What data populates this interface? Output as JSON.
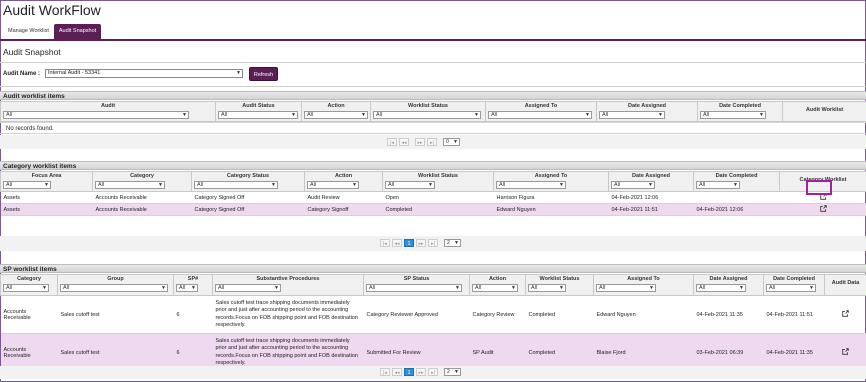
{
  "app": {
    "title": "Audit WorkFlow"
  },
  "tabs": [
    {
      "label": "Manage Worklist",
      "active": false
    },
    {
      "label": "Audit Snapshot",
      "active": true
    }
  ],
  "page": {
    "title": "Audit Snapshot"
  },
  "audit_selector": {
    "label": "Audit Name :",
    "value": "Internal Audit - 53341",
    "refresh_label": "Refresh"
  },
  "filter_default": "All",
  "audit_worklist": {
    "title": "Audit worklist items",
    "columns": [
      "Audit",
      "Audit Status",
      "Action",
      "Worklist Status",
      "Assigned To",
      "Date Assigned",
      "Date Completed",
      "Audit Worklist"
    ],
    "empty_text": "No records found.",
    "page_size": "0"
  },
  "category_worklist": {
    "title": "Category worklist items",
    "columns": [
      "Focus Area",
      "Category",
      "Category Status",
      "Action",
      "Worklist Status",
      "Assigned To",
      "Date Assigned",
      "Date Completed",
      "Category Worklist"
    ],
    "rows": [
      [
        "Assets",
        "Accounts Receivable",
        "Category Signed Off",
        "Audit Review",
        "Open",
        "Harrison Figura",
        "04-Feb-2021 12:06",
        "",
        ""
      ],
      [
        "Assets",
        "Accounts Receivable",
        "Category Signed Off",
        "Category Signoff",
        "Completed",
        "Edward Nguyen",
        "04-Feb-2021 11:51",
        "04-Feb-2021 12:06",
        ""
      ]
    ],
    "current_page": "1",
    "page_size": "2"
  },
  "sp_worklist": {
    "title": "SP worklist items",
    "columns": [
      "Category",
      "Group",
      "SP#",
      "Substantive Procedures",
      "SP Status",
      "Action",
      "Worklist Status",
      "Assigned To",
      "Date Assigned",
      "Date Completed",
      "Audit Data"
    ],
    "rows": [
      [
        "Accounts Receivable",
        "Sales cutoff test",
        "6",
        "Sales cutoff test trace shipping documents immediately prior and just after accounting period to the accounting records.Focus on FOB shipping point and FOB destination respectively.",
        "Category Reviewer Approved",
        "Category Review",
        "Completed",
        "Edward Nguyen",
        "04-Feb-2021 11:35",
        "04-Feb-2021 11:51",
        ""
      ],
      [
        "Accounts Receivable",
        "Sales cutoff test",
        "6",
        "Sales cutoff test trace shipping documents immediately prior and just after accounting period to the accounting records.Focus on FOB shipping point and FOB destination respectively.",
        "Submitted For Review",
        "SP Audit",
        "Completed",
        "Blaise Fjord",
        "03-Feb-2021 06:39",
        "04-Feb-2021 11:35",
        ""
      ]
    ],
    "current_page": "1",
    "page_size": "2"
  },
  "pager_icons": [
    "first-page-icon",
    "prev-page-icon",
    "next-page-icon",
    "last-page-icon"
  ],
  "colors": {
    "brand": "#5b1f55",
    "alt_row": "#eed9ee",
    "active_page": "#2f8fd8",
    "highlight": "#a020a0"
  }
}
